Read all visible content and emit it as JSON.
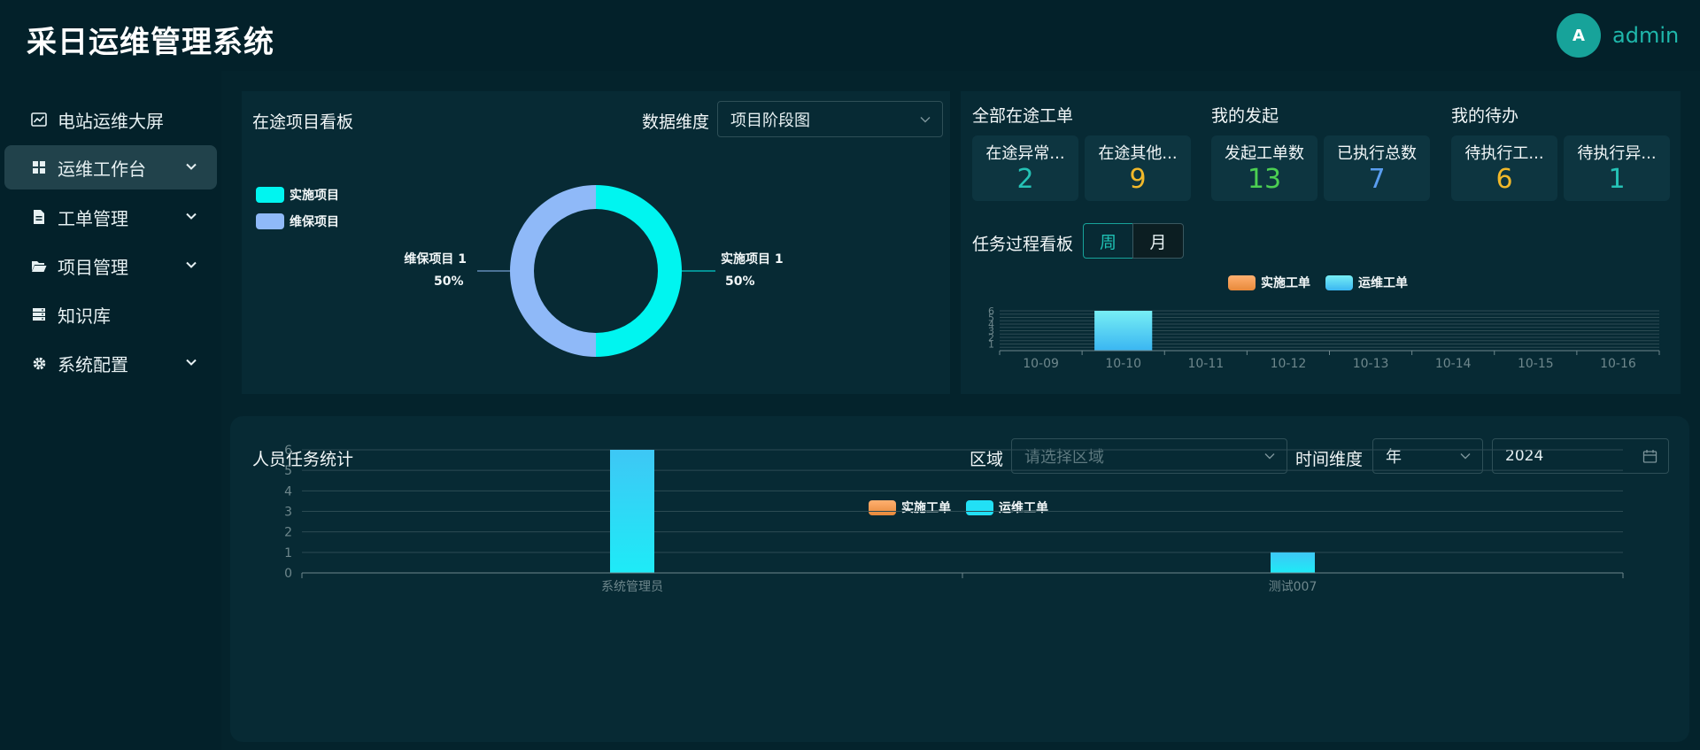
{
  "header": {
    "app_title": "采日运维管理系统",
    "avatar_initial": "A",
    "username": "admin"
  },
  "sidebar": {
    "items": [
      {
        "label": "电站运维大屏"
      },
      {
        "label": "运维工作台"
      },
      {
        "label": "工单管理"
      },
      {
        "label": "项目管理"
      },
      {
        "label": "知识库"
      },
      {
        "label": "系统配置"
      }
    ]
  },
  "project_board": {
    "title": "在途项目看板",
    "dimension_label": "数据维度",
    "dimension_value": "项目阶段图",
    "legend": [
      "实施项目",
      "维保项目"
    ],
    "slice_labels": [
      {
        "name": "实施项目 1",
        "pct": "50%"
      },
      {
        "name": "维保项目 1",
        "pct": "50%"
      }
    ]
  },
  "work_orders": {
    "groups": [
      {
        "title": "全部在途工单"
      },
      {
        "title": "我的发起"
      },
      {
        "title": "我的待办"
      }
    ],
    "cards": [
      {
        "label": "在途异常...",
        "value": "2"
      },
      {
        "label": "在途其他...",
        "value": "9"
      },
      {
        "label": "发起工单数",
        "value": "13"
      },
      {
        "label": "已执行总数",
        "value": "7"
      },
      {
        "label": "待执行工...",
        "value": "6"
      },
      {
        "label": "待执行异...",
        "value": "1"
      }
    ]
  },
  "task_board": {
    "title": "任务过程看板",
    "toggle": {
      "week": "周",
      "month": "月"
    },
    "legend": [
      "实施工单",
      "运维工单"
    ]
  },
  "personnel": {
    "title": "人员任务统计",
    "region_label": "区域",
    "region_placeholder": "请选择区域",
    "time_label": "时间维度",
    "time_value": "年",
    "year_value": "2024",
    "legend": [
      "实施工单",
      "运维工单"
    ]
  },
  "colors": {
    "accent": "#17a39a",
    "cyan": "#00f5f0",
    "light_blue": "#8fb9f8",
    "orange": "#f0a050",
    "stat_colors": [
      "#25c2b6",
      "#f1b82a",
      "#4ccf52",
      "#5a9ef0",
      "#f1b82a",
      "#25c2b6"
    ]
  },
  "chart_data": [
    {
      "type": "pie",
      "categories": [
        "实施项目",
        "维保项目"
      ],
      "values": [
        1,
        1
      ],
      "percent": [
        50,
        50
      ]
    },
    {
      "type": "bar",
      "categories": [
        "10-09",
        "10-10",
        "10-11",
        "10-12",
        "10-13",
        "10-14",
        "10-15",
        "10-16"
      ],
      "series": [
        {
          "name": "实施工单",
          "values": [
            0,
            0,
            0,
            0,
            0,
            0,
            0,
            0
          ]
        },
        {
          "name": "运维工单",
          "values": [
            0,
            6,
            0,
            0,
            0,
            0,
            0,
            0
          ]
        }
      ],
      "yticks": [
        "1",
        "2",
        "3",
        "4",
        "5",
        "6"
      ],
      "ylim": [
        0,
        6
      ]
    },
    {
      "type": "bar",
      "categories": [
        "系统管理员",
        "测试007"
      ],
      "series": [
        {
          "name": "实施工单",
          "values": [
            0,
            0
          ]
        },
        {
          "name": "运维工单",
          "values": [
            6,
            1
          ]
        }
      ],
      "yticks": [
        "0",
        "1",
        "2",
        "3",
        "4",
        "5",
        "6"
      ],
      "ylim": [
        0,
        6
      ]
    }
  ]
}
